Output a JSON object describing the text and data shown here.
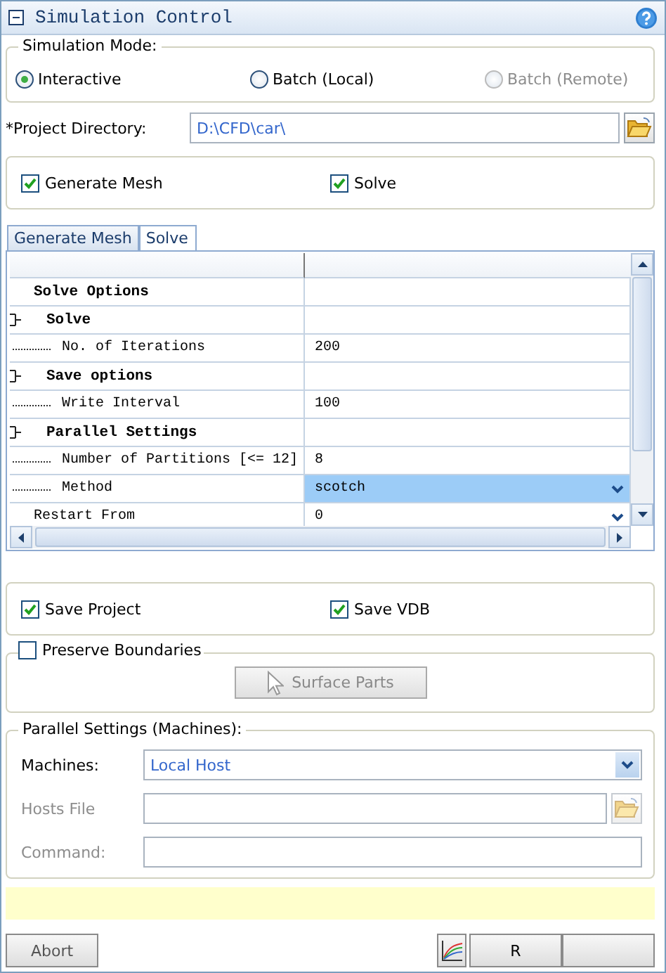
{
  "panel": {
    "title": "Simulation Control"
  },
  "simulation_mode": {
    "label": "Simulation Mode:",
    "options": [
      {
        "label": "Interactive",
        "selected": true,
        "disabled": false
      },
      {
        "label": "Batch (Local)",
        "selected": false,
        "disabled": false
      },
      {
        "label": "Batch (Remote)",
        "selected": false,
        "disabled": true
      }
    ]
  },
  "project_directory": {
    "label": "*Project Directory:",
    "value": "D:\\CFD\\car\\"
  },
  "steps": [
    {
      "label": "Generate Mesh",
      "checked": true
    },
    {
      "label": "Solve",
      "checked": true
    }
  ],
  "tabs": [
    {
      "label": "Generate Mesh",
      "selected": false
    },
    {
      "label": "Solve",
      "selected": true
    }
  ],
  "property_grid": {
    "rows": [
      {
        "kind": "category",
        "label": "Solve Options"
      },
      {
        "kind": "group",
        "label": "Solve",
        "children": [
          {
            "kind": "text",
            "label": "No. of Iterations",
            "value": "200",
            "selected": false
          }
        ]
      },
      {
        "kind": "group",
        "label": "Save options",
        "children": [
          {
            "kind": "text",
            "label": "Write Interval",
            "value": "100",
            "selected": false
          }
        ]
      },
      {
        "kind": "group",
        "label": "Parallel Settings",
        "children": [
          {
            "kind": "text",
            "label": "Number of Partitions [<= 12]",
            "value": "8",
            "selected": false
          },
          {
            "kind": "dropdown",
            "label": "Method",
            "value": "scotch",
            "selected": true
          }
        ]
      },
      {
        "kind": "dropdown",
        "label": "Restart From",
        "value": "0",
        "selected": false
      }
    ]
  },
  "outputs": [
    {
      "label": "Save Project",
      "checked": true
    },
    {
      "label": "Save VDB",
      "checked": true
    }
  ],
  "preserve_boundaries": {
    "label": "Preserve Boundaries",
    "checked": false,
    "button": {
      "label": "Surface Parts",
      "disabled": true
    }
  },
  "machines_group": {
    "title": "Parallel Settings (Machines):",
    "machines": {
      "label": "Machines:",
      "value": "Local Host",
      "disabled": false
    },
    "hosts_file": {
      "label": "Hosts File",
      "disabled": true
    },
    "command": {
      "label": "Command:",
      "disabled": true
    }
  },
  "buttons": [
    {
      "label": "Abort"
    },
    {
      "label": "R"
    }
  ]
}
